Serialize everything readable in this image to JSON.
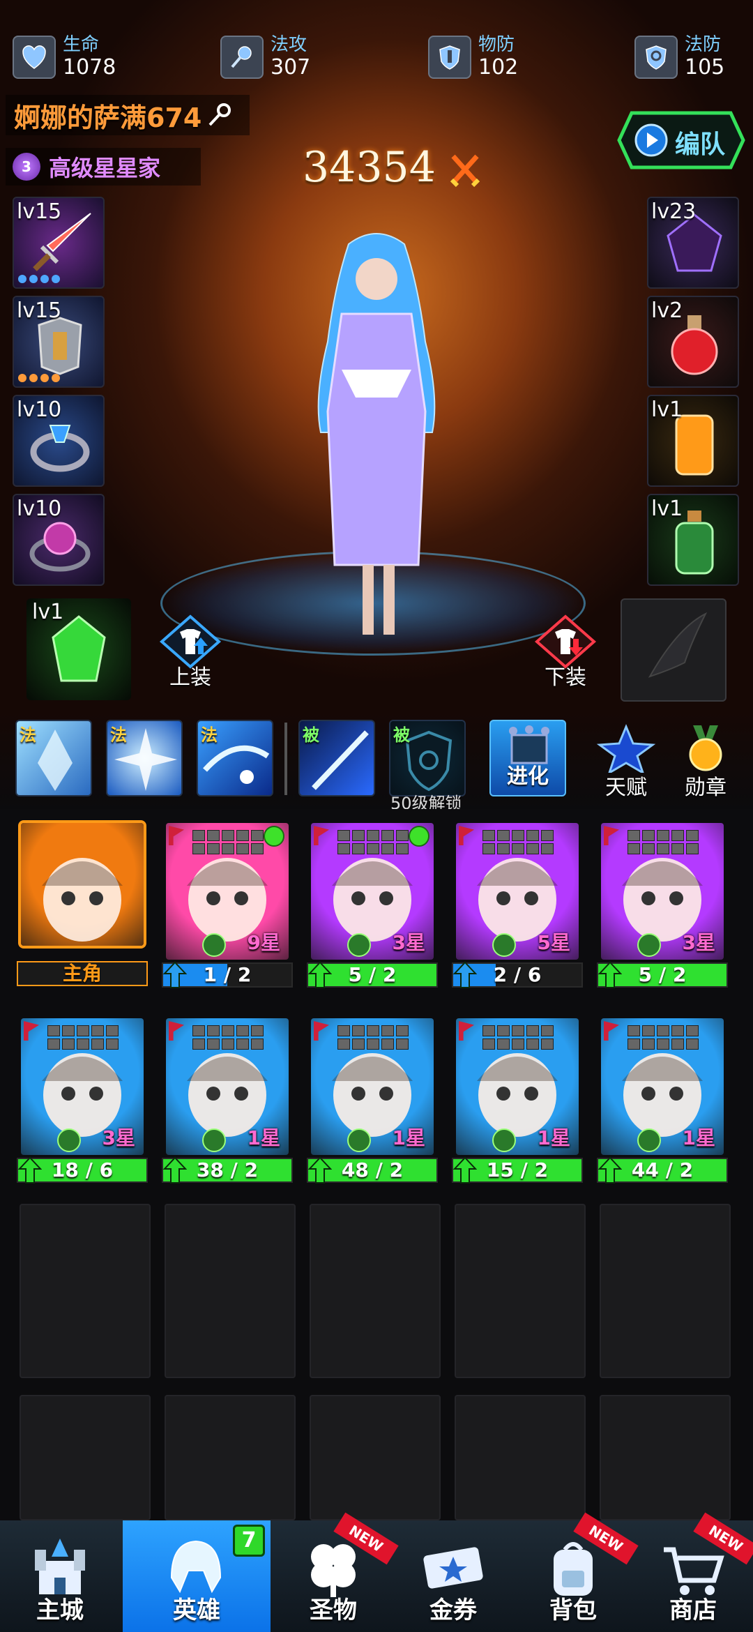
{
  "stats": [
    {
      "label": "生命",
      "value": "1078",
      "icon": "heart-shield-icon"
    },
    {
      "label": "法攻",
      "value": "307",
      "icon": "magic-wand-icon"
    },
    {
      "label": "物防",
      "value": "102",
      "icon": "armor-shield-icon"
    },
    {
      "label": "法防",
      "value": "105",
      "icon": "magic-shield-icon"
    }
  ],
  "player": {
    "name": "婀娜的萨满674",
    "rank_level": "3",
    "rank": "高级星星家",
    "power": "34354"
  },
  "team_button": {
    "label": "编队"
  },
  "left_equipment": [
    {
      "level": "lv15",
      "item": "sword"
    },
    {
      "level": "lv15",
      "item": "armor"
    },
    {
      "level": "lv10",
      "item": "ring"
    },
    {
      "level": "lv10",
      "item": "amulet"
    }
  ],
  "right_equipment": [
    {
      "level": "lv23",
      "item": "dark-crystal"
    },
    {
      "level": "lv2",
      "item": "red-potion"
    },
    {
      "level": "lv1",
      "item": "orange-jar"
    },
    {
      "level": "lv1",
      "item": "green-potion"
    }
  ],
  "gem": {
    "level": "lv1"
  },
  "equip_buttons": {
    "equip": "上装",
    "unequip": "下装"
  },
  "skills": [
    {
      "tag": "法",
      "name": "ice-crystal"
    },
    {
      "tag": "法",
      "name": "frost-star"
    },
    {
      "tag": "法",
      "name": "blizzard"
    },
    {
      "tag": "被",
      "name": "light-blade"
    },
    {
      "tag": "被",
      "name": "locked-shield"
    }
  ],
  "unlock_text": "50级解锁",
  "actions": {
    "evolve": "进化",
    "talent": "天赋",
    "medal": "勋章"
  },
  "heroes": [
    {
      "label": "主角",
      "progress": 1,
      "fill": "none",
      "stars": "",
      "color": "#f07a10",
      "is_main": true
    },
    {
      "label": "1 / 2",
      "progress": 0.5,
      "fill": "blue",
      "stars": "9星",
      "color": "#ff4aa8",
      "green_dot": true
    },
    {
      "label": "5 / 2",
      "progress": 1,
      "fill": "green",
      "stars": "3星",
      "color": "#b43aff",
      "green_dot": true
    },
    {
      "label": "2 / 6",
      "progress": 0.33,
      "fill": "blue",
      "stars": "5星",
      "color": "#b43aff"
    },
    {
      "label": "5 / 2",
      "progress": 1,
      "fill": "green",
      "stars": "3星",
      "color": "#b43aff"
    },
    {
      "label": "18 / 6",
      "progress": 1,
      "fill": "green",
      "stars": "3星",
      "color": "#2a9ef0"
    },
    {
      "label": "38 / 2",
      "progress": 1,
      "fill": "green",
      "stars": "1星",
      "color": "#2a9ef0"
    },
    {
      "label": "48 / 2",
      "progress": 1,
      "fill": "green",
      "stars": "1星",
      "color": "#2a9ef0"
    },
    {
      "label": "15 / 2",
      "progress": 1,
      "fill": "green",
      "stars": "1星",
      "color": "#2a9ef0"
    },
    {
      "label": "44 / 2",
      "progress": 1,
      "fill": "green",
      "stars": "1星",
      "color": "#2a9ef0"
    }
  ],
  "nav": [
    {
      "label": "主城",
      "icon": "castle-icon"
    },
    {
      "label": "英雄",
      "icon": "helmet-icon",
      "badge": "7",
      "active": true
    },
    {
      "label": "圣物",
      "icon": "clover-icon",
      "new": "NEW"
    },
    {
      "label": "金券",
      "icon": "ticket-icon"
    },
    {
      "label": "背包",
      "icon": "backpack-icon",
      "new": "NEW"
    },
    {
      "label": "商店",
      "icon": "cart-icon",
      "new": "NEW"
    }
  ],
  "colors": {
    "accent": "#2ea3ff",
    "green": "#2fe030",
    "blue": "#1b8cf0",
    "orange": "#ff9b3a"
  }
}
